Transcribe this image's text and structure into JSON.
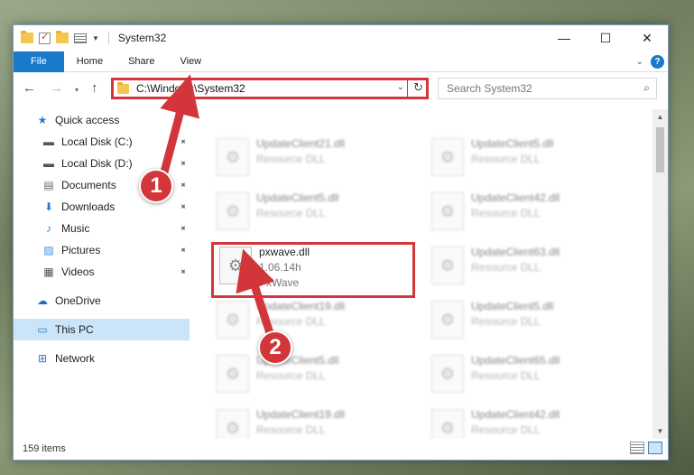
{
  "window": {
    "title": "System32",
    "controls": {
      "minimize": "—",
      "maximize": "☐",
      "close": "✕"
    }
  },
  "ribbon": {
    "tabs": [
      "File",
      "Home",
      "Share",
      "View"
    ],
    "expand_icon": "chevron-down-icon",
    "help_label": "?"
  },
  "nav_buttons": {
    "back": "←",
    "forward": "→",
    "recent": "▾",
    "up": "↑"
  },
  "address": {
    "path": "C:\\Windows\\System32",
    "dropdown": "⌄",
    "refresh": "↻"
  },
  "search": {
    "placeholder": "Search System32",
    "icon": "⌕"
  },
  "sidebar": {
    "items": [
      {
        "label": "Quick access",
        "icon": "★",
        "pinned": false
      },
      {
        "label": "Local Disk (C:)",
        "icon": "▬",
        "pinned": true
      },
      {
        "label": "Local Disk (D:)",
        "icon": "▬",
        "pinned": true
      },
      {
        "label": "Documents",
        "icon": "▤",
        "pinned": true
      },
      {
        "label": "Downloads",
        "icon": "⬇",
        "pinned": true
      },
      {
        "label": "Music",
        "icon": "♪",
        "pinned": true
      },
      {
        "label": "Pictures",
        "icon": "▨",
        "pinned": true
      },
      {
        "label": "Videos",
        "icon": "▦",
        "pinned": true
      },
      {
        "label": "OneDrive",
        "icon": "☁"
      },
      {
        "label": "This PC",
        "icon": "▭"
      },
      {
        "label": "Network",
        "icon": "⊞"
      }
    ],
    "pin_glyph": "📌"
  },
  "files": [
    {
      "name": "UpdateClient21.dll",
      "type": "Resource DLL"
    },
    {
      "name": "UpdateClient5.dll",
      "type": "Resource DLL"
    },
    {
      "name": "UpdateClient5.dll",
      "type": "Resource DLL"
    },
    {
      "name": "UpdateClient42.dll",
      "type": "Resource DLL"
    },
    {
      "name": "pxwave.dll",
      "version": "1.06.14h",
      "company": "PxWave"
    },
    {
      "name": "UpdateClient63.dll",
      "type": "Resource DLL"
    },
    {
      "name": "UpdateClient19.dll",
      "type": "Resource DLL"
    },
    {
      "name": "UpdateClient5.dll",
      "type": "Resource DLL"
    },
    {
      "name": "UpdateClient5.dll",
      "type": "Resource DLL"
    },
    {
      "name": "UpdateClient65.dll",
      "type": "Resource DLL"
    },
    {
      "name": "UpdateClient19.dll",
      "type": "Resource DLL"
    },
    {
      "name": "UpdateClient42.dll",
      "type": "Resource DLL"
    }
  ],
  "file_icon": "⚙",
  "status": {
    "item_count": "159 items"
  },
  "callouts": [
    "1",
    "2"
  ],
  "colors": {
    "accent": "#1979ca",
    "highlight": "#d2363a",
    "selected": "#cce4f7"
  }
}
